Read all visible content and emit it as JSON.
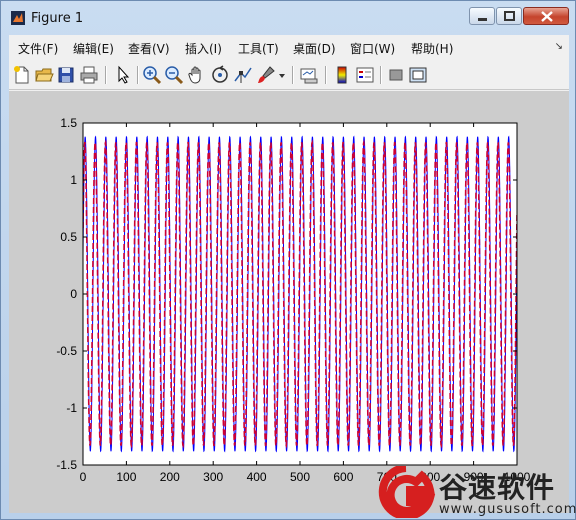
{
  "window": {
    "title": "Figure 1"
  },
  "menu": [
    "文件(F)",
    "编辑(E)",
    "查看(V)",
    "插入(I)",
    "工具(T)",
    "桌面(D)",
    "窗口(W)",
    "帮助(H)"
  ],
  "toolbar": {
    "icons": [
      "new-file-icon",
      "open-folder-icon",
      "save-icon",
      "print-icon",
      "pointer-icon",
      "zoom-in-icon",
      "zoom-out-icon",
      "pan-hand-icon",
      "rotate-3d-icon",
      "data-cursor-icon",
      "brush-icon",
      "dropdown-arrow-icon",
      "link-plot-icon",
      "colorbar-icon",
      "legend-icon",
      "hide-plot-tools-icon",
      "show-plot-tools-icon"
    ]
  },
  "watermark": {
    "name": "谷速软件",
    "url": "www.gususoft.com"
  },
  "chart_data": {
    "type": "line",
    "title": "",
    "xlabel": "",
    "ylabel": "",
    "xlim": [
      0,
      1000
    ],
    "ylim": [
      -1.5,
      1.5
    ],
    "xticks": [
      0,
      100,
      200,
      300,
      400,
      500,
      600,
      700,
      800,
      900,
      1000
    ],
    "xtick_labels": [
      "0",
      "100",
      "200",
      "300",
      "400",
      "500",
      "600",
      "700",
      "800",
      "900",
      "1000"
    ],
    "yticks": [
      -1.5,
      -1,
      -0.5,
      0,
      0.5,
      1,
      1.5
    ],
    "ytick_labels": [
      "-1.5",
      "-1",
      "-0.5",
      "0",
      "0.5",
      "1",
      "1.5"
    ],
    "grid": false,
    "series": [
      {
        "color": "#0000ff",
        "amplitude": 1.38,
        "period": 23.8,
        "phase": 0.25,
        "x_range": [
          0,
          1000
        ]
      },
      {
        "color": "#cc0033",
        "amplitude": 1.33,
        "period": 23.8,
        "phase": 0.45,
        "x_range": [
          0,
          1000
        ]
      }
    ]
  }
}
